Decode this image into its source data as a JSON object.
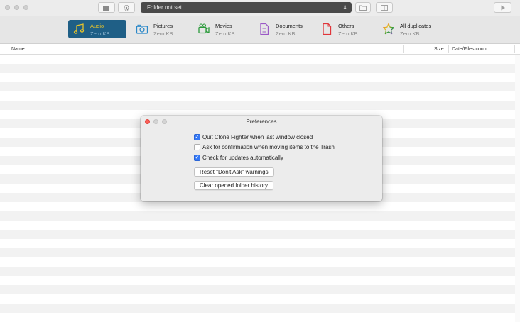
{
  "toolbar": {
    "path_text": "Folder not set",
    "icons": [
      "traffic-light-close",
      "traffic-light-minimize",
      "traffic-light-zoom",
      "folder-add-icon",
      "gear-icon",
      "chevron-updown-icon",
      "folder-icon",
      "panel-icon",
      "play-icon"
    ]
  },
  "categories": [
    {
      "name": "Audio",
      "size": "Zero KB",
      "icon": "music-note-icon",
      "active": true
    },
    {
      "name": "Pictures",
      "size": "Zero KB",
      "icon": "camera-icon"
    },
    {
      "name": "Movies",
      "size": "Zero KB",
      "icon": "video-camera-icon"
    },
    {
      "name": "Documents",
      "size": "Zero KB",
      "icon": "document-icon"
    },
    {
      "name": "Others",
      "size": "Zero KB",
      "icon": "blank-file-icon"
    },
    {
      "name": "All duplicates",
      "size": "Zero KB",
      "icon": "star-icon"
    }
  ],
  "columns": {
    "name": "Name",
    "size": "Size",
    "date": "Date/Files count"
  },
  "dialog": {
    "title": "Preferences",
    "options": [
      {
        "label": "Quit Clone Fighter when last window closed",
        "checked": true
      },
      {
        "label": "Ask for confirmation when moving items to the Trash",
        "checked": false
      },
      {
        "label": "Check for updates automatically",
        "checked": true
      }
    ],
    "buttons": {
      "reset": "Reset \"Don't Ask\" warnings",
      "clear": "Clear opened folder history"
    }
  },
  "colors": {
    "active_category_bg": "#1f5f86",
    "active_category_text": "#e8c42a",
    "checkbox_on": "#3478f6",
    "close_dot": "#fc5f57"
  }
}
